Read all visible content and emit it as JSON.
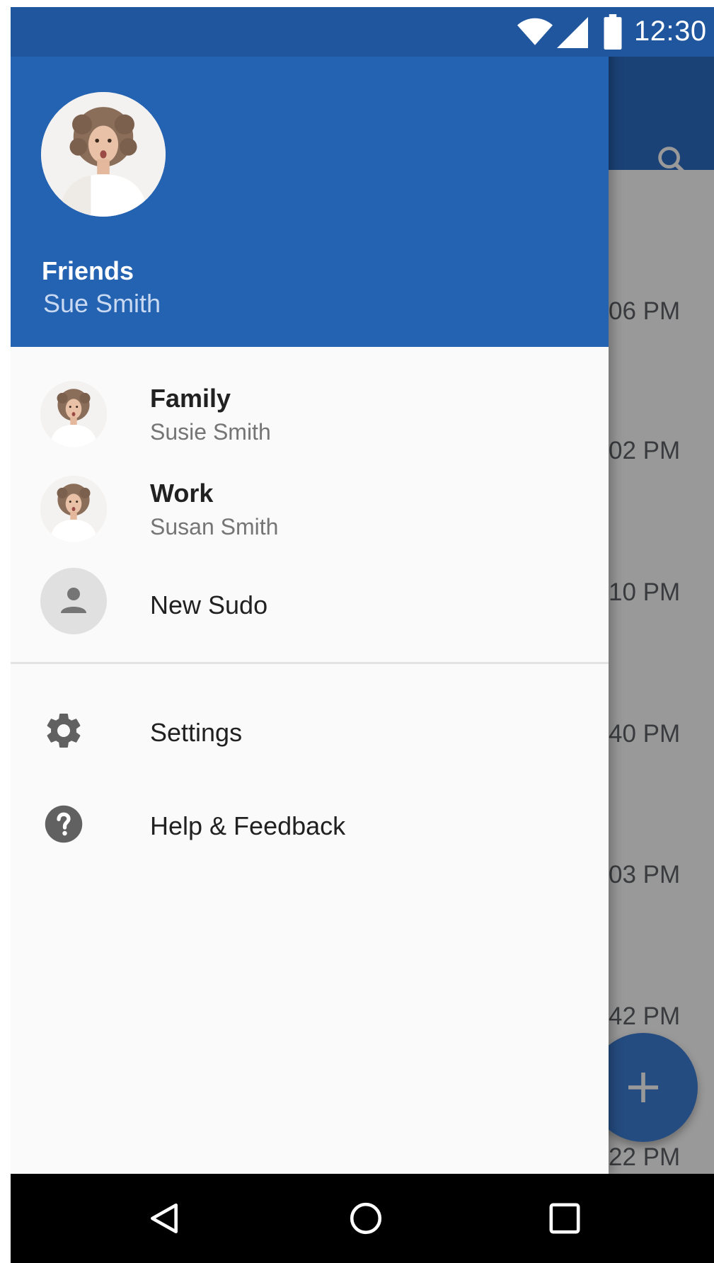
{
  "status_bar": {
    "time": "12:30",
    "icons": [
      "wifi-icon",
      "signal-icon",
      "battery-icon"
    ]
  },
  "background_app": {
    "list_times": [
      "06 PM",
      "02 PM",
      "10 PM",
      "40 PM",
      "03 PM",
      "42 PM",
      "22 PM"
    ],
    "icons": [
      "search-icon",
      "contacts-icon",
      "add-icon"
    ],
    "accent_color": "#2d6fc6"
  },
  "drawer": {
    "header": {
      "name": "Friends",
      "subtitle": "Sue Smith",
      "background_color": "#2462b2"
    },
    "accounts": [
      {
        "title": "Family",
        "subtitle": "Susie Smith"
      },
      {
        "title": "Work",
        "subtitle": "Susan Smith"
      }
    ],
    "new_sudo_label": "New Sudo",
    "menu": [
      {
        "label": "Settings",
        "icon": "gear-icon"
      },
      {
        "label": "Help & Feedback",
        "icon": "help-icon"
      }
    ]
  },
  "nav_bar": {
    "icons": [
      "back-icon",
      "home-icon",
      "recents-icon"
    ]
  }
}
